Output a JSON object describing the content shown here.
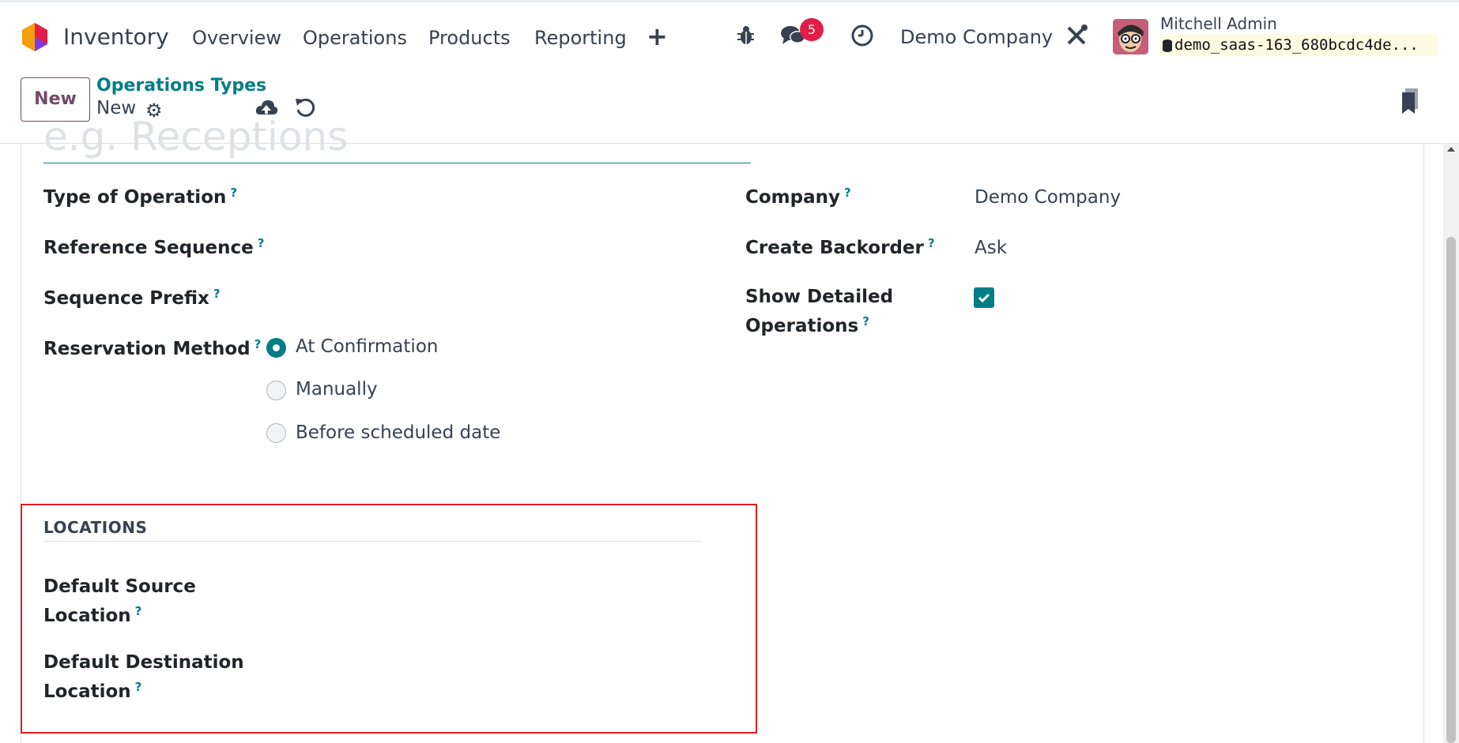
{
  "navbar": {
    "app_name": "Inventory",
    "menu": [
      "Overview",
      "Operations",
      "Products",
      "Reporting"
    ],
    "messages_count": "5",
    "company": "Demo Company",
    "user_name": "Mitchell Admin",
    "database": "demo_saas-163_680bcdc4de..."
  },
  "control": {
    "new_label": "New",
    "breadcrumb_parent": "Operations Types",
    "breadcrumb_current": "New"
  },
  "form": {
    "name_placeholder": "e.g. Receptions",
    "left": {
      "type_of_operation": "Type of Operation",
      "reference_sequence": "Reference Sequence",
      "sequence_prefix": "Sequence Prefix",
      "reservation_method": "Reservation Method",
      "reservation_options": [
        "At Confirmation",
        "Manually",
        "Before scheduled date"
      ],
      "reservation_selected": "At Confirmation"
    },
    "right": {
      "company_label": "Company",
      "company_value": "Demo Company",
      "backorder_label": "Create Backorder",
      "backorder_value": "Ask",
      "detailed_label_1": "Show Detailed",
      "detailed_label_2": "Operations",
      "detailed_checked": true
    },
    "locations": {
      "title": "LOCATIONS",
      "source_1": "Default Source",
      "source_2": "Location",
      "dest_1": "Default Destination",
      "dest_2": "Location"
    },
    "help_mark": "?"
  },
  "colors": {
    "primary": "#714b67",
    "accent": "#017e84",
    "badge": "#e11d48",
    "highlight": "#e11d20"
  },
  "icons": [
    "odoo-logo-icon",
    "plus-icon",
    "bug-icon",
    "chat-icon",
    "clock-icon",
    "tools-icon",
    "database-icon",
    "gear-icon",
    "cloud-upload-icon",
    "discard-icon",
    "bookmark-icon",
    "check-icon"
  ]
}
